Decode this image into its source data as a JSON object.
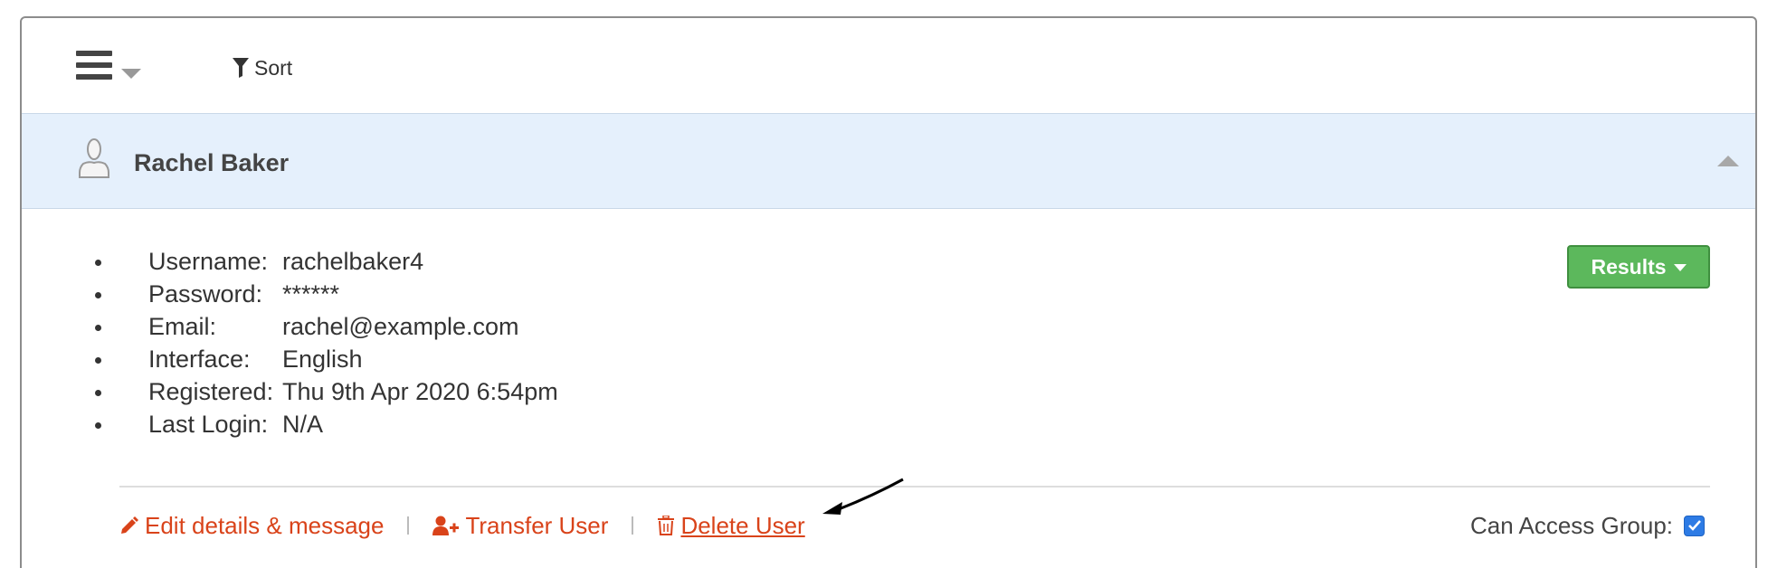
{
  "toolbar": {
    "menu_icon": "hamburger-icon",
    "sort_label": "Sort",
    "sort_icon": "filter-icon"
  },
  "user": {
    "name": "Rachel Baker",
    "avatar_icon": "user-silhouette-icon"
  },
  "details": [
    {
      "label": "Username:",
      "value": "rachelbaker4"
    },
    {
      "label": "Password:",
      "value": "******"
    },
    {
      "label": "Email:",
      "value": "rachel@example.com"
    },
    {
      "label": "Interface:",
      "value": "English"
    },
    {
      "label": "Registered:",
      "value": "Thu 9th Apr 2020 6:54pm"
    },
    {
      "label": "Last Login:",
      "value": "N/A"
    }
  ],
  "results_button": {
    "label": "Results"
  },
  "actions": {
    "edit_label": "Edit details & message",
    "transfer_label": "Transfer User",
    "delete_label": "Delete User"
  },
  "access": {
    "label": "Can Access Group:",
    "checked": true
  },
  "colors": {
    "accent_link": "#d9431a",
    "header_bg": "#e5f0fc",
    "results_green": "#5cb85c",
    "checkbox_blue": "#2d7be5"
  }
}
